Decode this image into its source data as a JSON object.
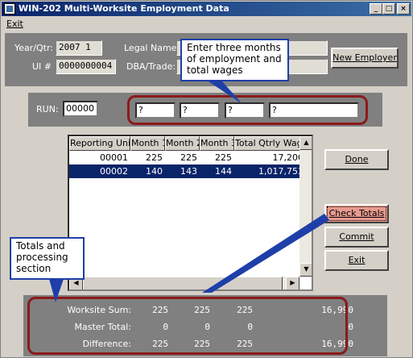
{
  "window": {
    "title": "WIN-202 Multi-Worksite Employment Data",
    "controls": [
      "_",
      "□",
      "×"
    ]
  },
  "menu": {
    "exit": "Exit"
  },
  "header": {
    "year_qtr_label": "Year/Qtr:",
    "year_qtr_value": "2007  1",
    "ui_label": "UI #",
    "ui_value": "0000000004",
    "legal_name_label": "Legal Name:",
    "legal_name_value": "",
    "dba_label": "DBA/Trade:",
    "dba_value": "",
    "new_employer_button": "New Employer"
  },
  "run_section": {
    "run_label": "RUN:",
    "run_value": "00000",
    "month1_value": "?",
    "month2_value": "?",
    "month3_value": "?",
    "wages_value": "?"
  },
  "callouts": {
    "top": "Enter three months of employment and total wages",
    "bottom": "Totals and processing section"
  },
  "grid": {
    "columns": [
      "Reporting Unit",
      "Month 1",
      "Month 2",
      "Month 3",
      "Total Qtrly Wages"
    ],
    "rows": [
      {
        "unit": "00001",
        "m1": "225",
        "m2": "225",
        "m3": "225",
        "wages": "17,200",
        "selected": false
      },
      {
        "unit": "00002",
        "m1": "140",
        "m2": "143",
        "m3": "144",
        "wages": "1,017,753",
        "selected": true
      }
    ]
  },
  "buttons": {
    "done": "Done",
    "check_totals": "Check Totals",
    "commit": "Commit",
    "exit": "Exit"
  },
  "totals": {
    "worksite_label": "Worksite Sum:",
    "worksite": [
      "225",
      "225",
      "225",
      "16,990"
    ],
    "master_label": "Master Total:",
    "master": [
      "0",
      "0",
      "0",
      "0"
    ],
    "difference_label": "Difference:",
    "difference": [
      "225",
      "225",
      "225",
      "16,990"
    ]
  },
  "colors": {
    "callout_border": "#1f3fa8",
    "ring": "#8b1a1a",
    "selection": "#0a246a",
    "check_totals_bg": "#e89a8e"
  }
}
